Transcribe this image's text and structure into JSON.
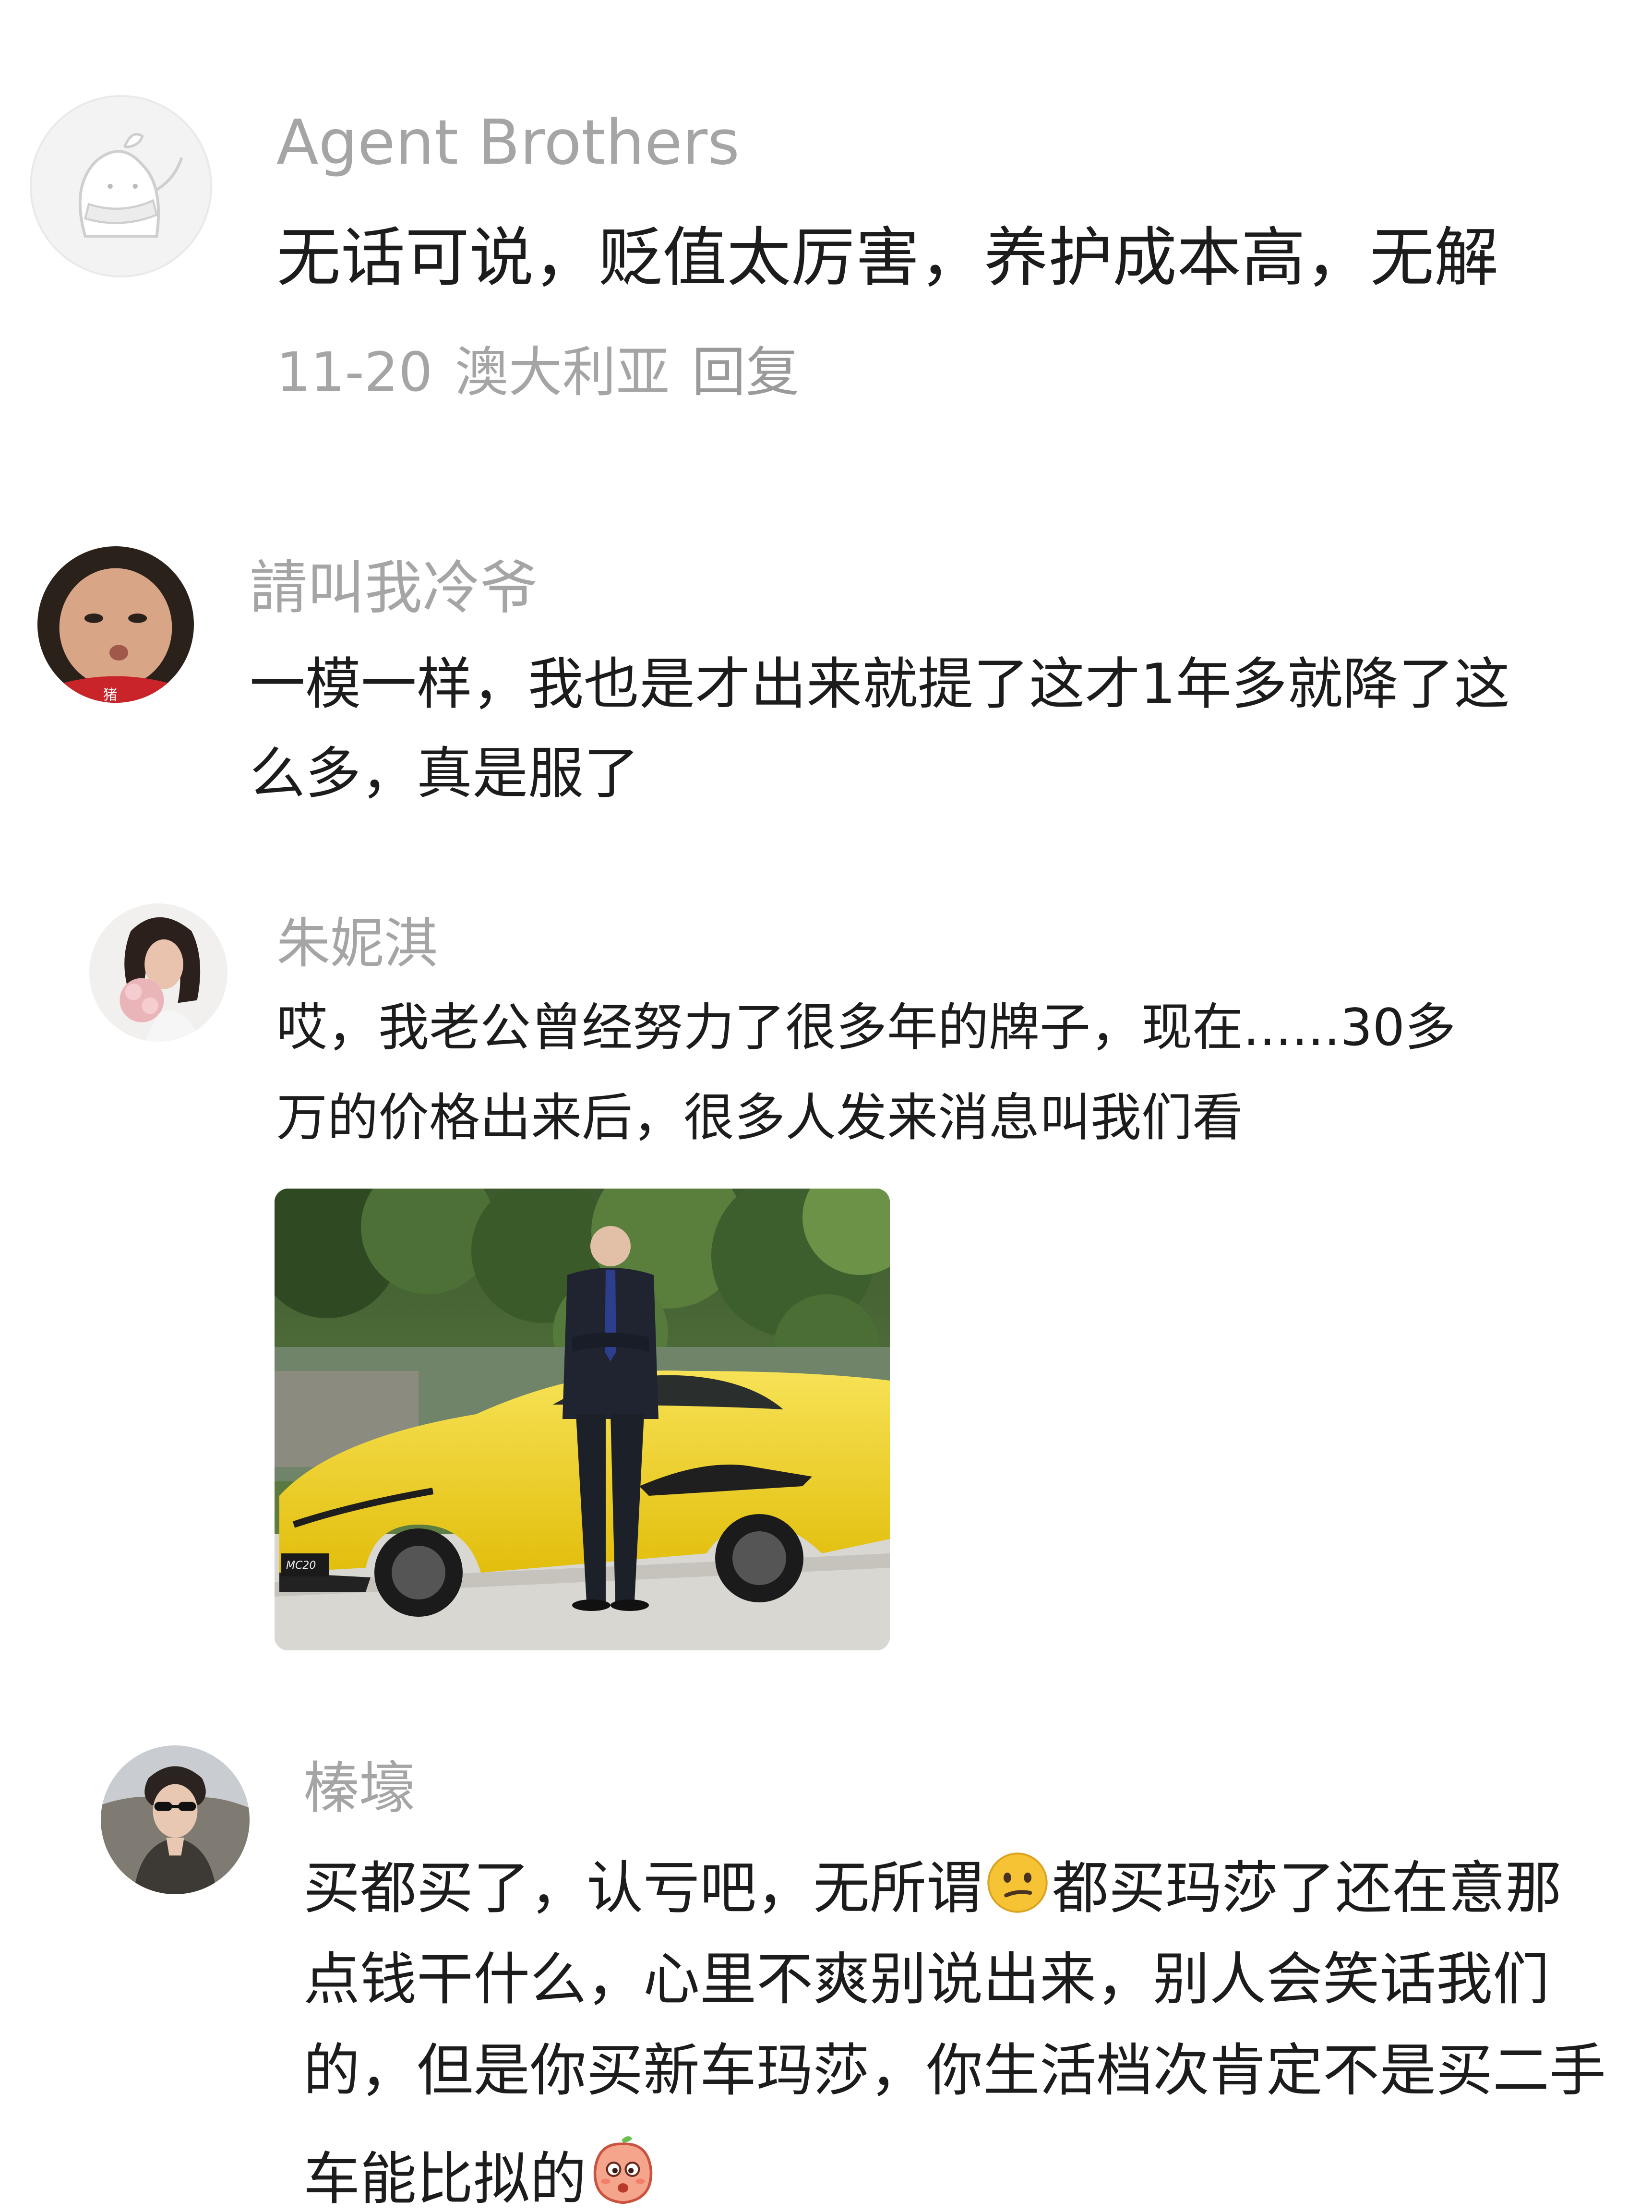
{
  "comments": [
    {
      "author": "Agent Brothers",
      "lines": [
        "无话可说，贬值太厉害，养护成本高，无解"
      ],
      "date": "11-20",
      "location": "澳大利亚",
      "reply_label": "回复"
    },
    {
      "author": "請叫我冷爷",
      "lines": [
        "一模一样，我也是才出来就提了这才1年多就降了这",
        "么多，真是服了"
      ],
      "avatar_caption": "猪"
    },
    {
      "author": "朱妮淇",
      "lines": [
        "哎，我老公曾经努力了很多年的牌子，现在......30多",
        "万的价格出来后，很多人发来消息叫我们看"
      ],
      "photo_badge": "MC20"
    },
    {
      "author": "榛壕",
      "line1_before_emoji": "买都买了，认亏吧，无所谓",
      "line1_after_emoji": "都买玛莎了还在意那",
      "line2": "点钱干什么，心里不爽别说出来，别人会笑话我们",
      "line3": "的，但是你买新车玛莎，你生活档次肯定不是买二手",
      "line4": "车能比拟的"
    }
  ],
  "icons": {
    "emoji_1": "confused-face-emoji",
    "emoji_2": "peach-face-emoji"
  },
  "colors": {
    "author": "#a5a5a5",
    "text": "#1c1c1c",
    "car_yellow": "#f1d21a"
  }
}
